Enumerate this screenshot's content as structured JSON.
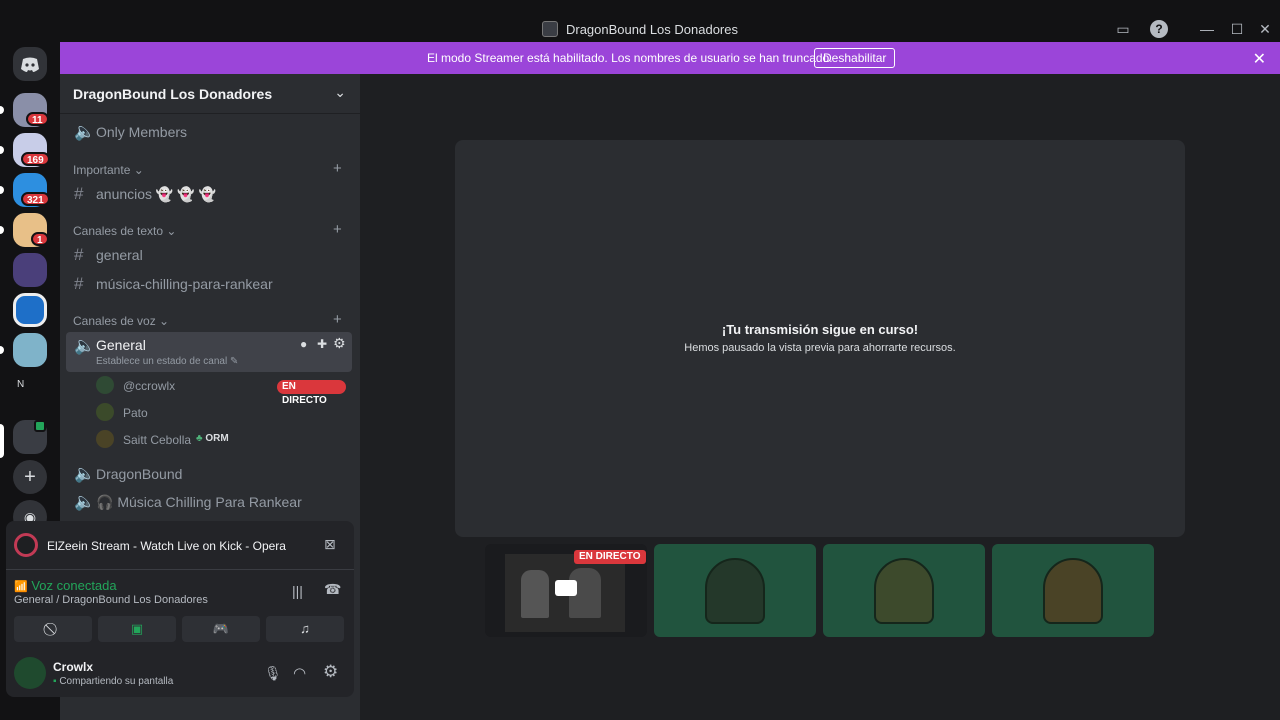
{
  "window": {
    "title": "DragonBound Los Donadores"
  },
  "banner": {
    "message": "El modo Streamer está habilitado. Los nombres de usuario se han truncado.",
    "button_label": "Deshabilitar",
    "color": "#9b45d9"
  },
  "servers": [
    {
      "badge": "11"
    },
    {
      "badge": "169"
    },
    {
      "badge": "321"
    },
    {
      "badge": "1"
    },
    {
      "badge": ""
    },
    {
      "badge": ""
    },
    {
      "badge": ""
    },
    {
      "label": "N"
    }
  ],
  "sidebar": {
    "guild_name": "DragonBound Los Donadores",
    "channels": {
      "only_members": "Only Members",
      "cat_importante": "Importante",
      "anuncios": "anuncios 👻 👻 👻",
      "cat_texto": "Canales de texto",
      "general_text": "general",
      "musica_text": "música-chilling-para-rankear",
      "cat_voz": "Canales de voz",
      "general_voice": "General",
      "general_voice_status": "Establece un estado de canal",
      "dragonbound_voice": "DragonBound",
      "musica_voice": "🎧 Música Chilling Para Rankear"
    },
    "voice_users": [
      {
        "name": "@ccrowlx",
        "live": "EN DIRECTO"
      },
      {
        "name": "Pato"
      },
      {
        "name": "Saitt Cebolla",
        "tag": "ORM"
      }
    ]
  },
  "stream_panel": {
    "activity": "ElZeein Stream - Watch Live on Kick - Opera",
    "voice_status": "Voz conectada",
    "voice_location": "General / DragonBound Los Donadores",
    "status_color": "#23a55a"
  },
  "user": {
    "name": "Crowlx",
    "status": "Compartiendo su pantalla"
  },
  "main": {
    "preview_title": "¡Tu transmisión sigue en curso!",
    "preview_subtitle": "Hemos pausado la vista previa para ahorrarte recursos.",
    "tile_live_label": "EN DIRECTO"
  }
}
